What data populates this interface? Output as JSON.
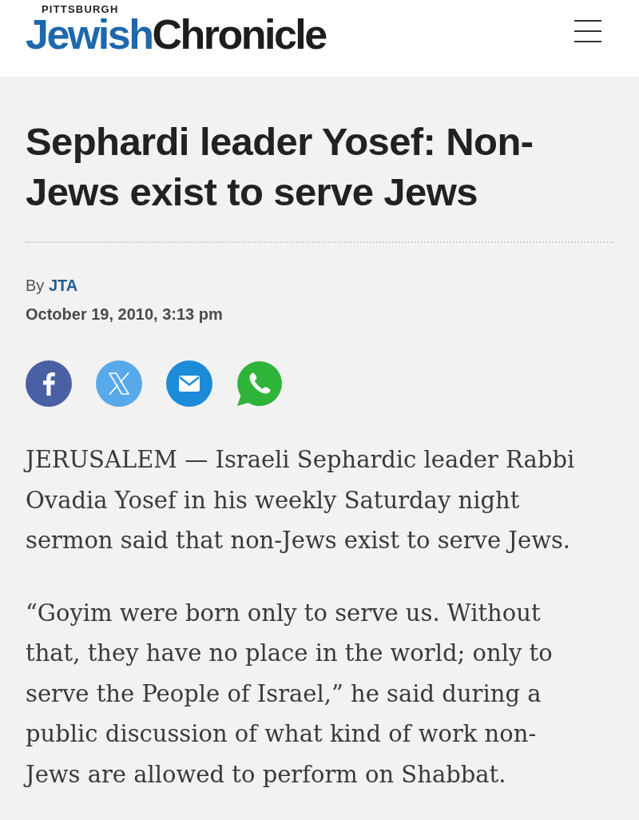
{
  "header": {
    "logo": {
      "top_line": "PITTSBURGH",
      "first_word": "Jewish",
      "second_word": "Chronicle"
    }
  },
  "article": {
    "headline": "Sephardi leader Yosef: Non-Jews exist to serve Jews",
    "byline": {
      "prefix": "By",
      "author": "JTA"
    },
    "date": "October 19, 2010, 3:13 pm",
    "share_buttons": [
      {
        "kind": "facebook"
      },
      {
        "kind": "x"
      },
      {
        "kind": "email"
      },
      {
        "kind": "whatsapp"
      }
    ],
    "paragraphs": [
      "JERUSALEM — Israeli Sephardic leader Rabbi Ovadia Yosef in his weekly Saturday night sermon said that non-Jews exist to serve Jews.",
      "“Goyim were born only to serve us. Without that, they have no place in the world; only to serve the People of Israel,” he said during a public discussion of what kind of work non-Jews are allowed to perform on Shabbat."
    ]
  }
}
